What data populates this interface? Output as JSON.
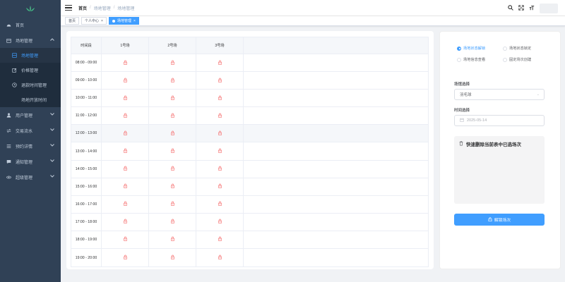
{
  "sidebar": {
    "items": [
      {
        "label": "首页",
        "icon": "dashboard-icon"
      },
      {
        "label": "场地管理",
        "icon": "calendar-icon",
        "expanded": true
      },
      {
        "label": "场地管理",
        "icon": "grid-icon",
        "active": true,
        "sub": true
      },
      {
        "label": "价格管理",
        "icon": "edit-icon",
        "sub": true
      },
      {
        "label": "退款时间管理",
        "icon": "clock-icon",
        "sub": true
      },
      {
        "label": "场地开放时间",
        "icon": "open-time-icon",
        "sub": true
      },
      {
        "label": "用户管理",
        "icon": "user-icon"
      },
      {
        "label": "交易流水",
        "icon": "exchange-icon"
      },
      {
        "label": "预约详情",
        "icon": "list-icon"
      },
      {
        "label": "通知管理",
        "icon": "message-icon"
      },
      {
        "label": "超级管理",
        "icon": "eye-icon"
      }
    ]
  },
  "breadcrumb": [
    "首页",
    "场地管理",
    "场地管理"
  ],
  "tags": [
    {
      "label": "首页",
      "active": false,
      "closable": false
    },
    {
      "label": "个人中心",
      "active": false,
      "closable": true
    },
    {
      "label": "场地管理",
      "active": true,
      "closable": true
    }
  ],
  "table": {
    "headers": [
      "时间段",
      "1号场",
      "2号场",
      "3号场"
    ],
    "rows": [
      "08:00 - 09:00",
      "09:00 - 10:00",
      "10:00 - 11:00",
      "11:00 - 12:00",
      "12:00 - 13:00",
      "13:00 - 14:00",
      "14:00 - 15:00",
      "15:00 - 16:00",
      "16:00 - 17:00",
      "17:00 - 18:00",
      "18:00 - 19:00",
      "19:00 - 20:00"
    ],
    "hover_row": 4
  },
  "panel": {
    "radios": [
      {
        "label": "场地状态解锁",
        "checked": true
      },
      {
        "label": "场地状态锁定",
        "checked": false
      },
      {
        "label": "场地信息查看",
        "checked": false
      },
      {
        "label": "固定场次创建",
        "checked": false
      }
    ],
    "venue_label": "场馆选择",
    "venue_value": "羽毛球",
    "time_label": "时间选择",
    "date_value": "2025-05-14",
    "quick_delete_title": "快速删除当前表中已选场次",
    "unlock_button": "解锁场次"
  },
  "colors": {
    "sidebar_bg": "#304156",
    "accent": "#409eff",
    "lock": "#f56c6c"
  }
}
